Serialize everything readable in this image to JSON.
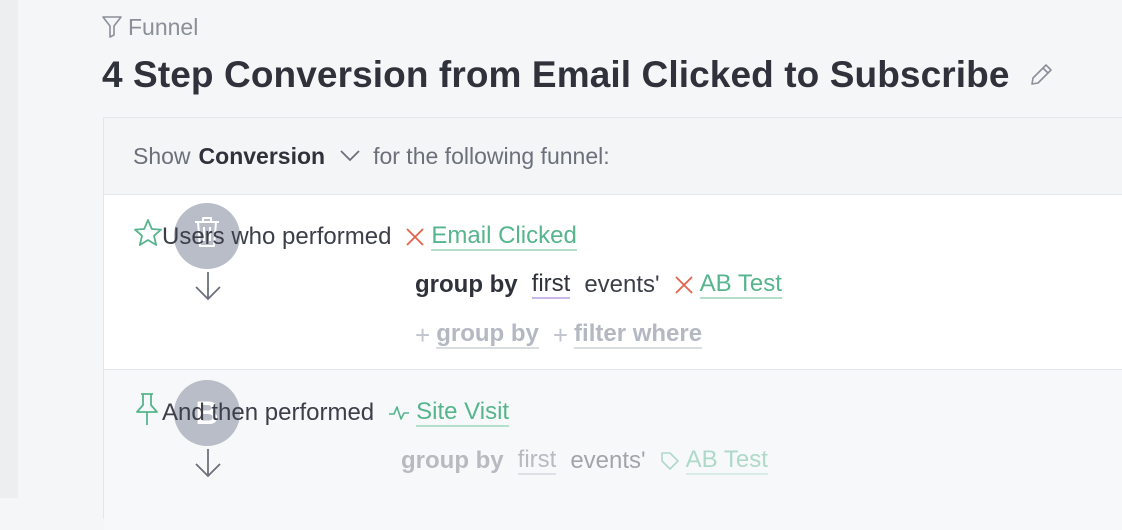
{
  "report": {
    "kind": "Funnel",
    "title": "4 Step Conversion from Email Clicked to Subscribe"
  },
  "header": {
    "prefix": "Show",
    "metric": "Conversion",
    "suffix": "for the following funnel:"
  },
  "steps": [
    {
      "badge": "",
      "lead": "Users who performed",
      "event": "Email Clicked",
      "group_by_label": "group by",
      "group_by_mode": "first",
      "events_word": "events'",
      "property": "AB Test",
      "add_group_by": "group by",
      "add_filter": "filter where"
    },
    {
      "badge": "B",
      "lead": "And then performed",
      "event": "Site Visit",
      "group_by_label": "group by",
      "group_by_mode": "first",
      "events_word": "events'",
      "property": "AB Test"
    }
  ],
  "colors": {
    "accent_green": "#56b58d",
    "remove_red": "#e2634a",
    "badge_gray": "#b8bdc8"
  },
  "icons": {
    "report_kind": "funnel-icon",
    "edit": "pencil-icon",
    "step_a_side": "star-icon",
    "step_a_badge": "trash-icon",
    "step_b_side": "pin-icon",
    "event_b": "activity-icon",
    "property_b": "tag-icon"
  }
}
